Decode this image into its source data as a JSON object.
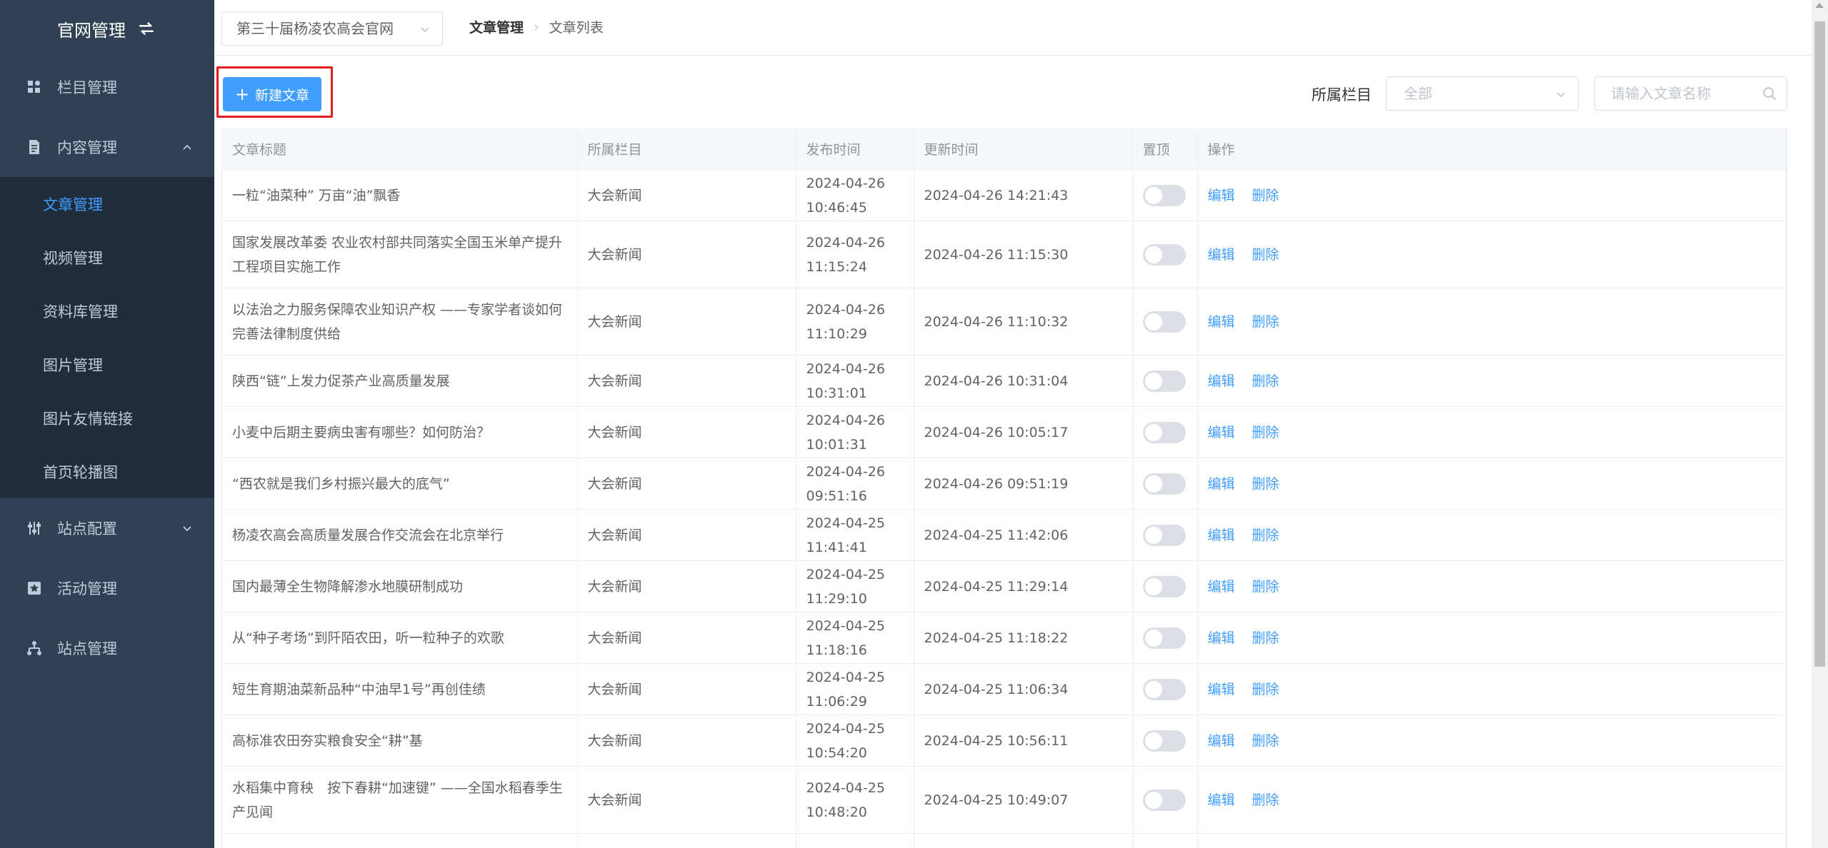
{
  "app": {
    "title": "官网管理"
  },
  "sidebar": {
    "items": [
      {
        "label": "栏目管理",
        "icon": "grid-icon"
      },
      {
        "label": "内容管理",
        "icon": "document-icon",
        "expanded": true,
        "children": [
          {
            "label": "文章管理",
            "active": true
          },
          {
            "label": "视频管理"
          },
          {
            "label": "资料库管理"
          },
          {
            "label": "图片管理"
          },
          {
            "label": "图片友情链接"
          },
          {
            "label": "首页轮播图"
          }
        ]
      },
      {
        "label": "站点配置",
        "icon": "settings-icon",
        "expanded": false
      },
      {
        "label": "活动管理",
        "icon": "star-icon"
      },
      {
        "label": "站点管理",
        "icon": "sitemap-icon"
      }
    ]
  },
  "header": {
    "site_select": "第三十届杨凌农高会官网",
    "breadcrumb": [
      "文章管理",
      "文章列表"
    ]
  },
  "toolbar": {
    "new_button": "新建文章",
    "filter_label": "所属栏目",
    "category_value": "全部",
    "search_placeholder": "请输入文章名称"
  },
  "colors": {
    "accent": "#409eff",
    "sidebar_bg": "#304156",
    "highlight": "#e31b1b"
  },
  "table": {
    "headers": [
      "文章标题",
      "所属栏目",
      "发布时间",
      "更新时间",
      "置顶",
      "操作"
    ],
    "actions": {
      "edit": "编辑",
      "delete": "删除"
    },
    "rows": [
      {
        "title": "一粒“油菜种” 万亩“油”飘香",
        "category": "大会新闻",
        "published": "2024-04-26 10:46:45",
        "updated": "2024-04-26 14:21:43"
      },
      {
        "title": "国家发展改革委 农业农村部共同落实全国玉米单产提升工程项目实施工作",
        "category": "大会新闻",
        "published": "2024-04-26 11:15:24",
        "updated": "2024-04-26 11:15:30"
      },
      {
        "title": "以法治之力服务保障农业知识产权 ——专家学者谈如何完善法律制度供给",
        "category": "大会新闻",
        "published": "2024-04-26 11:10:29",
        "updated": "2024-04-26 11:10:32"
      },
      {
        "title": "陕西“链”上发力促茶产业高质量发展",
        "category": "大会新闻",
        "published": "2024-04-26 10:31:01",
        "updated": "2024-04-26 10:31:04"
      },
      {
        "title": "小麦中后期主要病虫害有哪些？如何防治？",
        "category": "大会新闻",
        "published": "2024-04-26 10:01:31",
        "updated": "2024-04-26 10:05:17"
      },
      {
        "title": "“西农就是我们乡村振兴最大的底气”",
        "category": "大会新闻",
        "published": "2024-04-26 09:51:16",
        "updated": "2024-04-26 09:51:19"
      },
      {
        "title": "杨凌农高会高质量发展合作交流会在北京举行",
        "category": "大会新闻",
        "published": "2024-04-25 11:41:41",
        "updated": "2024-04-25 11:42:06"
      },
      {
        "title": "国内最薄全生物降解渗水地膜研制成功",
        "category": "大会新闻",
        "published": "2024-04-25 11:29:10",
        "updated": "2024-04-25 11:29:14"
      },
      {
        "title": "从“种子考场”到阡陌农田，听一粒种子的欢歌",
        "category": "大会新闻",
        "published": "2024-04-25 11:18:16",
        "updated": "2024-04-25 11:18:22"
      },
      {
        "title": "短生育期油菜新品种“中油早1号”再创佳绩",
        "category": "大会新闻",
        "published": "2024-04-25 11:06:29",
        "updated": "2024-04-25 11:06:34"
      },
      {
        "title": "高标准农田夯实粮食安全“耕”基",
        "category": "大会新闻",
        "published": "2024-04-25 10:54:20",
        "updated": "2024-04-25 10:56:11"
      },
      {
        "title": "水稻集中育秧　按下春耕“加速键” ——全国水稻春季生产见闻",
        "category": "大会新闻",
        "published": "2024-04-25 10:48:20",
        "updated": "2024-04-25 10:49:07"
      },
      {
        "title": "",
        "category": "",
        "published": "",
        "updated": ""
      }
    ]
  }
}
